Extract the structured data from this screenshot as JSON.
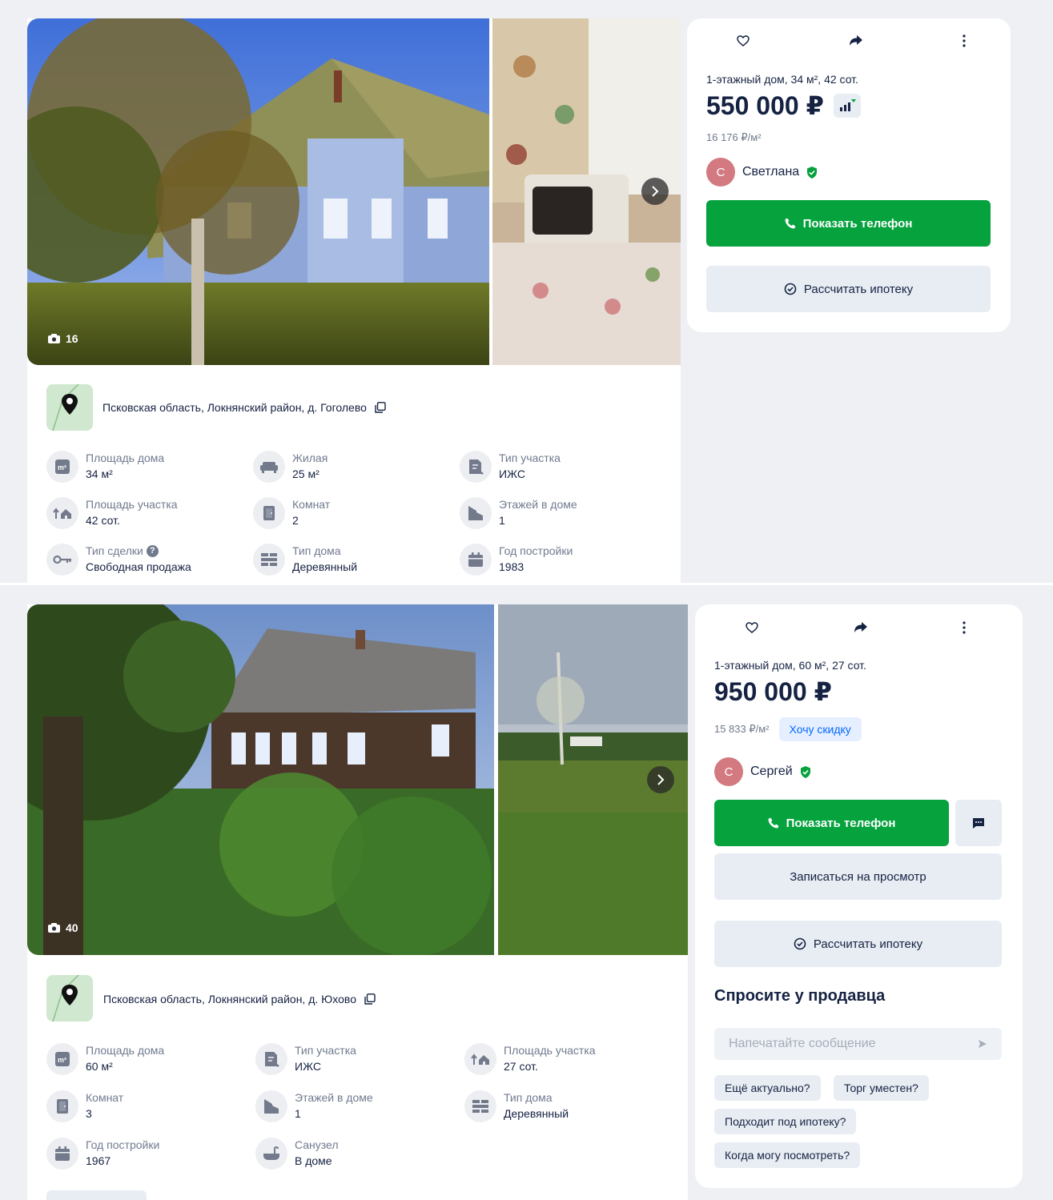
{
  "listings": [
    {
      "photo_count": "16",
      "address": "Псковская область, Локнянский район, д. Гоголево",
      "features": [
        {
          "label": "Площадь дома",
          "value": "34 м²",
          "icon": "area-m2-icon"
        },
        {
          "label": "Жилая",
          "value": "25 м²",
          "icon": "sofa-icon"
        },
        {
          "label": "Тип участка",
          "value": "ИЖС",
          "icon": "land-type-icon"
        },
        {
          "label": "Площадь участка",
          "value": "42 сот.",
          "icon": "plot-area-icon"
        },
        {
          "label": "Комнат",
          "value": "2",
          "icon": "door-icon"
        },
        {
          "label": "Этажей в доме",
          "value": "1",
          "icon": "floors-icon"
        },
        {
          "label": "Тип сделки",
          "value": "Свободная продажа",
          "icon": "key-icon"
        },
        {
          "label": "Тип дома",
          "value": "Деревянный",
          "icon": "bricks-icon"
        },
        {
          "label": "Год постройки",
          "value": "1983",
          "icon": "calendar-icon"
        }
      ],
      "side": {
        "title": "1-этажный дом, 34 м², 42 сот.",
        "price": "550 000 ₽",
        "price_per_m2": "16 176 ₽/м²",
        "seller_initial": "С",
        "seller_name": "Светлана",
        "phone_button": "Показать телефон",
        "mortgage_button": "Рассчитать ипотеку"
      }
    },
    {
      "photo_count": "40",
      "address": "Псковская область, Локнянский район, д. Юхово",
      "features": [
        {
          "label": "Площадь дома",
          "value": "60 м²",
          "icon": "area-m2-icon"
        },
        {
          "label": "Тип участка",
          "value": "ИЖС",
          "icon": "land-type-icon"
        },
        {
          "label": "Площадь участка",
          "value": "27 сот.",
          "icon": "plot-area-icon"
        },
        {
          "label": "Комнат",
          "value": "3",
          "icon": "door-icon"
        },
        {
          "label": "Этажей в доме",
          "value": "1",
          "icon": "floors-icon"
        },
        {
          "label": "Тип дома",
          "value": "Деревянный",
          "icon": "bricks-icon"
        },
        {
          "label": "Год постройки",
          "value": "1967",
          "icon": "calendar-icon"
        },
        {
          "label": "Санузел",
          "value": "В доме",
          "icon": "bathtub-icon"
        }
      ],
      "side": {
        "title": "1-этажный дом, 60 м², 27 сот.",
        "price": "950 000 ₽",
        "price_per_m2": "15 833 ₽/м²",
        "discount_button": "Хочу скидку",
        "seller_initial": "С",
        "seller_name": "Сергей",
        "phone_button": "Показать телефон",
        "viewing_button": "Записаться на просмотр",
        "mortgage_button": "Рассчитать ипотеку",
        "ask_title": "Спросите у продавца",
        "message_placeholder": "Напечатайте сообщение",
        "quick_questions": [
          "Ещё актуально?",
          "Торг уместен?",
          "Подходит под ипотеку?",
          "Когда могу посмотреть?"
        ]
      }
    }
  ],
  "colors": {
    "green": "#05a23e",
    "blue": "#0468ff",
    "text": "#152242",
    "muted": "#707a8f"
  }
}
